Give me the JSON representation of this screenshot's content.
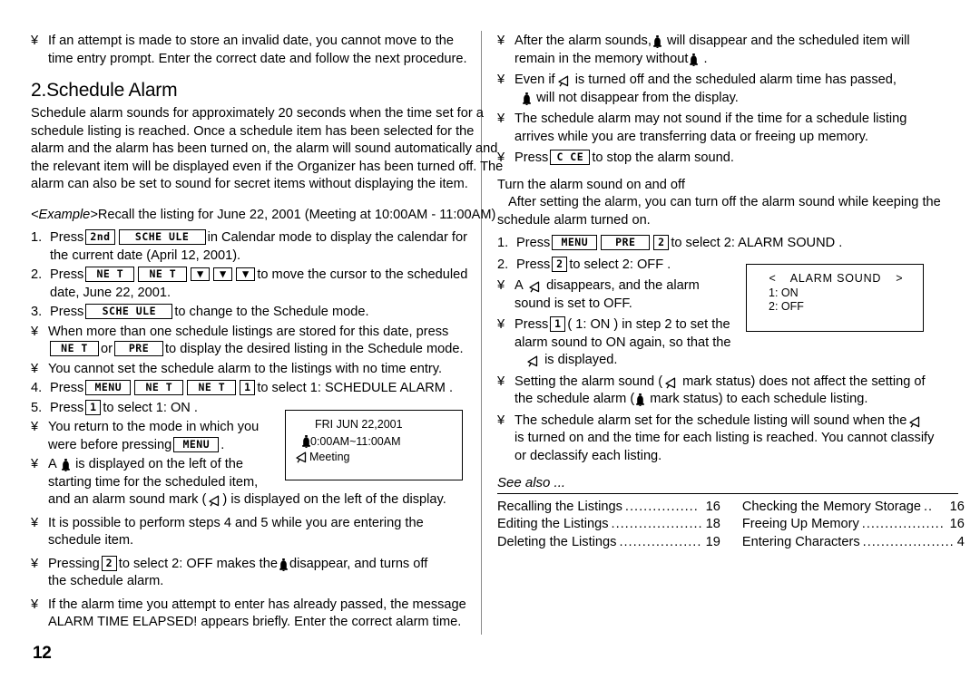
{
  "page": {
    "number": "12",
    "icons": {
      "bell": "bell-icon",
      "alarm_sound": "alarm-sound-icon"
    }
  },
  "left_column": {
    "top_note": {
      "bullet": "¥",
      "line1": "If an attempt is made to store an invalid date, you cannot move to the",
      "line2": "time entry prompt. Enter the correct date and follow the next procedure."
    },
    "section_title": "2.Schedule Alarm",
    "intro": "Schedule alarm sounds for approximately 20 seconds when the time set for a schedule listing is reached. Once a schedule item has been selected for the alarm and the alarm has been turned on, the alarm will sound automatically and the relevant item will be displayed even if the Organizer has been turned off. The alarm can also be set to sound for secret items without displaying the item.",
    "example_label": "<Example>",
    "example_text": "Recall the listing for June 22, 2001 (Meeting at 10:00AM - 11:00AM)",
    "steps": [
      {
        "num": "1.",
        "pre": "Press",
        "keys": [
          "2nd",
          "SCHE ULE"
        ],
        "post": "in Calendar mode to display the calendar for",
        "line2": "the current date (April 12, 2001)."
      },
      {
        "num": "2.",
        "pre": "Press",
        "keys": [
          "NE T",
          "NE T",
          "▼",
          "▼",
          "▼"
        ],
        "post": "to move the cursor to the scheduled",
        "line2": "date, June 22, 2001."
      },
      {
        "num": "3.",
        "pre": "Press",
        "keys": [
          "SCHE ULE"
        ],
        "post": "to change to the Schedule mode.",
        "line2": ""
      }
    ],
    "note_multiple": {
      "bullet": "¥",
      "line1": "When more than one schedule listings are stored for this date, press",
      "key1": "NE T",
      "mid": "or",
      "key2": "PRE",
      "line2_tail": "to display the desired listing in the Schedule mode."
    },
    "note_no_time": {
      "bullet": "¥",
      "text": "You cannot set the schedule alarm to the listings with no time entry."
    },
    "step4": {
      "num": "4.",
      "pre": "Press",
      "keys": [
        "MENU",
        "NE T",
        "NE T",
        "1"
      ],
      "post": "to select  1: SCHEDULE ALARM ."
    },
    "step5": {
      "num": "5.",
      "pre": "Press",
      "keys": [
        "1"
      ],
      "post": "to select  1: ON ."
    },
    "note_return": {
      "bullet": "¥",
      "line1": "You return to the mode in which you",
      "line2_pre": "were before pressing",
      "line2_key": "MENU",
      "line2_post": "."
    },
    "note_bell": {
      "bullet": "¥",
      "line1_pre": "A",
      "line1_post": "is displayed on the left of the",
      "line2": "starting time for the scheduled item,",
      "line3_pre": "and an alarm sound mark (",
      "line3_post": ") is displayed on the left of the display."
    },
    "note_steps45": {
      "bullet": "¥",
      "line1": "It is possible to perform steps 4 and 5 while you are entering the",
      "line2": "schedule item."
    },
    "note_off": {
      "bullet": "¥",
      "pre": "Pressing",
      "key": "2",
      "mid": "to select  2: OFF  makes the",
      "post": "disappear, and turns off",
      "line2": "the schedule alarm."
    },
    "note_elapsed": {
      "bullet": "¥",
      "line1": "If the alarm time you attempt to enter has already passed, the message",
      "line2": "ALARM TIME ELAPSED!  appears briefly. Enter the correct alarm time."
    },
    "lcd_schedule": {
      "line1": "FRI JUN 22,2001",
      "line2": "0:00AM~11:00AM",
      "line3": "Meeting"
    }
  },
  "right_column": {
    "note_after_sounds": {
      "bullet": "¥",
      "line1_pre": "After the alarm sounds,",
      "line1_post": "will disappear and the scheduled item will",
      "line2_pre": "remain in the memory without",
      "line2_post": "."
    },
    "note_even_if": {
      "bullet": "¥",
      "line1_pre": "Even if",
      "line1_post": "is turned off and the scheduled alarm time has passed,",
      "line2_post": "will not disappear from the display."
    },
    "note_may_not_sound": {
      "bullet": "¥",
      "line1": "The schedule alarm may not sound if the time for a schedule listing",
      "line2": "arrives while you are transferring data or freeing up memory."
    },
    "note_stop": {
      "bullet": "¥",
      "pre": "Press",
      "key": "C CE",
      "post": "to stop the alarm sound."
    },
    "subsection_title": "Turn the alarm sound on and off",
    "subsection_text": "After setting the alarm, you can turn off the alarm sound while keeping the schedule alarm turned on.",
    "step1": {
      "num": "1.",
      "pre": "Press",
      "keys": [
        "MENU",
        "PRE",
        "2"
      ],
      "post": "to select  2: ALARM SOUND ."
    },
    "step2": {
      "num": "2.",
      "pre": "Press",
      "keys": [
        "2"
      ],
      "post": "to select  2: OFF ."
    },
    "note_disappears": {
      "bullet": "¥",
      "line1_pre": "A",
      "line1_post": "disappears, and the alarm",
      "line2": "sound is set to OFF."
    },
    "note_press1": {
      "bullet": "¥",
      "pre": "Press",
      "key": "1",
      "post": "( 1: ON ) in step 2 to set the",
      "line2": "alarm sound to ON again, so that the",
      "line3_post": "is displayed."
    },
    "note_setting": {
      "bullet": "¥",
      "line1_pre": "Setting the alarm sound (",
      "line1_post": "mark status) does not affect the setting of",
      "line2_pre": "the schedule alarm (",
      "line2_post": "mark status) to each schedule listing."
    },
    "note_will_sound": {
      "bullet": "¥",
      "line1_pre": "The schedule alarm set for the schedule listing will sound when the",
      "line2": "is turned on and the time for each listing is reached. You cannot classify",
      "line3": "or declassify each listing."
    },
    "lcd_alarm_sound": {
      "left_arrow": "<",
      "title": "ALARM SOUND",
      "right_arrow": ">",
      "option1": "1: ON",
      "option2": "2: OFF"
    },
    "see_also": {
      "title": "See also ...",
      "entries_left": [
        {
          "label": "Recalling the Listings",
          "dots": "................",
          "page": "16"
        },
        {
          "label": "Editing the Listings",
          "dots": "....................",
          "page": "18"
        },
        {
          "label": "Deleting the Listings",
          "dots": "..................",
          "page": "19"
        }
      ],
      "entries_right": [
        {
          "label": "Checking the Memory Storage",
          "dots": "..",
          "page": "16"
        },
        {
          "label": "Freeing Up Memory",
          "dots": "..................",
          "page": "16"
        },
        {
          "label": "Entering Characters",
          "dots": "....................",
          "page": "4"
        }
      ]
    }
  }
}
